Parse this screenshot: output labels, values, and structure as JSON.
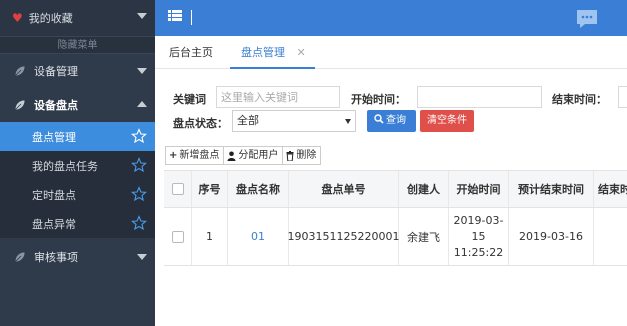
{
  "sidebar": {
    "favorites_label": "我的收藏",
    "hide_menu_label": "隐藏菜单",
    "groups": [
      {
        "label": "设备管理"
      },
      {
        "label": "设备盘点"
      },
      {
        "label": "审核事项"
      }
    ],
    "sub_items": [
      {
        "label": "盘点管理"
      },
      {
        "label": "我的盘点任务"
      },
      {
        "label": "定时盘点"
      },
      {
        "label": "盘点异常"
      }
    ]
  },
  "tabs": {
    "home_label": "后台主页",
    "active_label": "盘点管理",
    "close_glyph": "✕"
  },
  "search": {
    "keyword_label": "关键词",
    "keyword_placeholder": "这里输入关键词",
    "start_label": "开始时间：",
    "end_label": "结束时间：",
    "status_label": "盘点状态：",
    "status_value": "全部",
    "query_label": "查询",
    "clear_label": "清空条件"
  },
  "toolbar": {
    "add_label": "新增盘点",
    "assign_label": "分配用户",
    "delete_label": "删除"
  },
  "table": {
    "headers": [
      "序号",
      "盘点名称",
      "盘点单号",
      "创建人",
      "开始时间",
      "预计结束时间",
      "结束时"
    ],
    "rows": [
      {
        "index": "1",
        "name": "01",
        "number": "1903151125220001",
        "creator": "余建飞",
        "start_line1": "2019-03-",
        "start_line2": "15",
        "start_line3": "11:25:22",
        "planned_end": "2019-03-16",
        "end": ""
      }
    ]
  },
  "colors": {
    "accent": "#3a7fd5",
    "sidebar_bg": "#2f3a4a",
    "danger": "#e0504b",
    "favorite_heart": "#e2403f"
  }
}
